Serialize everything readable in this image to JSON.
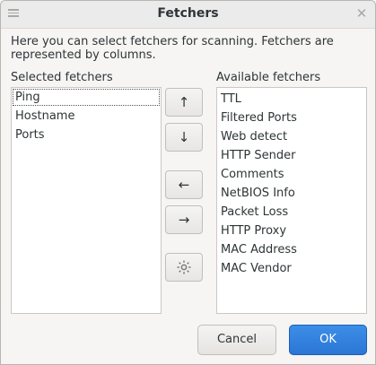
{
  "window": {
    "title": "Fetchers"
  },
  "description": "Here you can select fetchers for scanning. Fetchers are represented by columns.",
  "selected": {
    "label": "Selected fetchers",
    "items": [
      "Ping",
      "Hostname",
      "Ports"
    ]
  },
  "available": {
    "label": "Available fetchers",
    "items": [
      "TTL",
      "Filtered Ports",
      "Web detect",
      "HTTP Sender",
      "Comments",
      "NetBIOS Info",
      "Packet Loss",
      "HTTP Proxy",
      "MAC Address",
      "MAC Vendor"
    ]
  },
  "buttons": {
    "up": "↑",
    "down": "↓",
    "add": "←",
    "remove": "→",
    "cancel": "Cancel",
    "ok": "OK"
  },
  "icons": {
    "menu": "hamburger-menu-icon",
    "close": "close-icon",
    "settings": "gear-icon"
  },
  "colors": {
    "accent": "#2a76d5"
  }
}
